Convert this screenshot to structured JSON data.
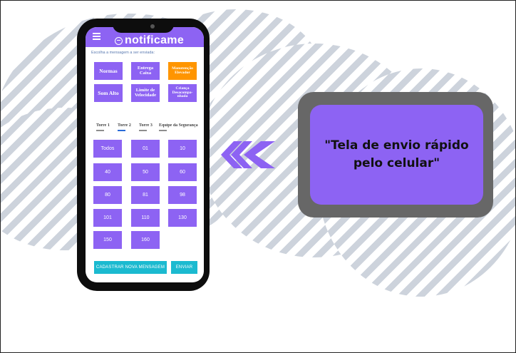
{
  "colors": {
    "accent": "#8d63f3",
    "selected": "#ff9500",
    "action": "#1bbad0",
    "frame": "#676767",
    "stripe": "#cdd3dc"
  },
  "app": {
    "title": "notificame",
    "hint": "Escolha a mensagem a ser enviada:",
    "messages": [
      {
        "lines": [
          "Normas"
        ],
        "selected": false
      },
      {
        "lines": [
          "Entrega",
          "Caixa"
        ],
        "selected": false
      },
      {
        "lines": [
          "Manutenção",
          "Elevador"
        ],
        "selected": true
      },
      {
        "lines": [
          "Som Alto"
        ],
        "selected": false
      },
      {
        "lines": [
          "Limite de",
          "Velocidade"
        ],
        "selected": false
      },
      {
        "lines": [
          "Criança",
          "Desacompa-",
          "nhada"
        ],
        "selected": false
      }
    ],
    "tabs": [
      {
        "label": "Torre 1",
        "active": false
      },
      {
        "label": "Torre 2",
        "active": true
      },
      {
        "label": "Torre 3",
        "active": false
      },
      {
        "label": "Equipe da Segurança",
        "active": false
      }
    ],
    "apartments": [
      "Todos",
      "01",
      "10",
      "40",
      "50",
      "60",
      "80",
      "81",
      "98",
      "101",
      "110",
      "130",
      "150",
      "160"
    ],
    "buttons": {
      "register": "CADASTRAR NOVA MENSAGEM",
      "send": "ENVIAR"
    }
  },
  "callout": {
    "text": "\"Tela de envio rápido pelo celular\""
  }
}
